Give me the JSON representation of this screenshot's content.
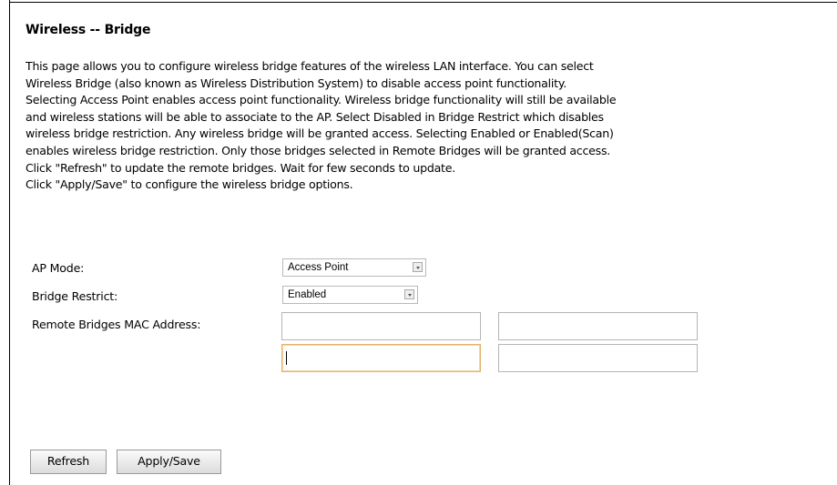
{
  "page": {
    "title": "Wireless -- Bridge",
    "description_lines": [
      "This page allows you to configure wireless bridge features of the wireless LAN interface. You can select",
      "Wireless Bridge (also known as Wireless Distribution System) to disable access point functionality.",
      "Selecting Access Point enables access point functionality. Wireless bridge functionality will still be available",
      "and wireless stations will be able to associate to the AP. Select Disabled in Bridge Restrict which disables",
      "wireless bridge restriction. Any wireless bridge will be granted access. Selecting Enabled or Enabled(Scan)",
      "enables wireless bridge restriction. Only those bridges selected in Remote Bridges will be granted access.",
      "Click \"Refresh\" to update the remote bridges. Wait for few seconds to update.",
      "Click \"Apply/Save\" to configure the wireless bridge options."
    ]
  },
  "form": {
    "ap_mode": {
      "label": "AP Mode:",
      "selected": "Access Point"
    },
    "bridge_restrict": {
      "label": "Bridge Restrict:",
      "selected": "Enabled"
    },
    "remote_bridges": {
      "label": "Remote Bridges MAC Address:",
      "fields": [
        "",
        "",
        "",
        ""
      ]
    }
  },
  "buttons": {
    "refresh": "Refresh",
    "apply_save": "Apply/Save"
  },
  "colors": {
    "focus_border": "#e3b36d",
    "field_border": "#b5b5b5"
  }
}
